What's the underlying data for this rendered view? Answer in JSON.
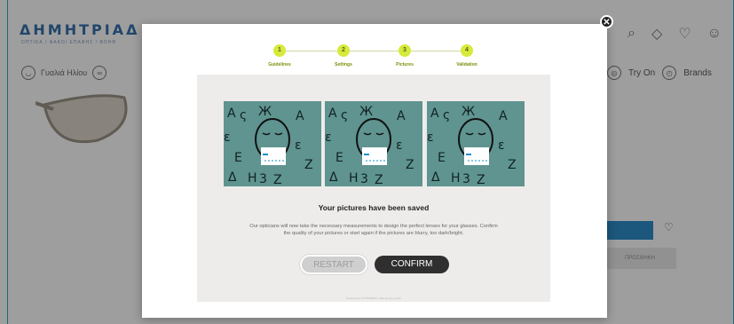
{
  "header": {
    "brand": "ΔΗΜΗΤΡΙΑΔ",
    "brand_sub": "ΟΠΤΙΚΑ / ΦΑΚΟΙ ΕΠΑΦΗΣ / ΒΟΗΘ",
    "nav_item_1": "Γυαλιά Ηλίου",
    "try_on": "Try On",
    "brands": "Brands"
  },
  "modal": {
    "steps": [
      {
        "number": "1",
        "label": "Guidelines"
      },
      {
        "number": "2",
        "label": "Settings"
      },
      {
        "number": "3",
        "label": "Pictures"
      },
      {
        "number": "4",
        "label": "Validation"
      }
    ],
    "title": "Your pictures have been saved",
    "description": "Our opticians will now take the necessary measurements to design the perfect lenses for your glasses. Confirm the quality of your pictures or start again if the pictures are blurry, too dark/bright.",
    "restart_label": "RESTART",
    "confirm_label": "CONFIRM",
    "powered_by": "Powered by FITTINGBOX | data privacy policy",
    "close_icon": "x-icon"
  },
  "page": {
    "buy_button_label": "",
    "secondary_button_label": "ΠΡΟΣΘΗΚΗ"
  }
}
